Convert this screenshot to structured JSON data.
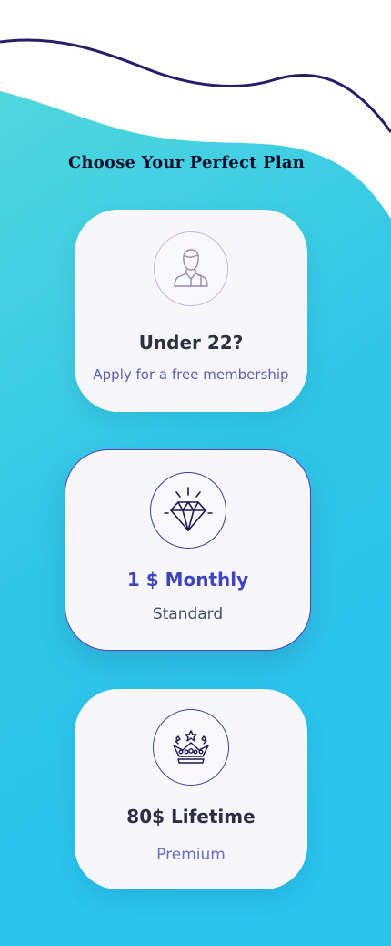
{
  "heading": "Choose Your Perfect Plan",
  "plans": [
    {
      "title": "Under 22?",
      "subtitle": "Apply for a free membership",
      "icon": "student-icon"
    },
    {
      "title": "1 $ Monthly",
      "subtitle": "Standard",
      "icon": "diamond-icon"
    },
    {
      "title": "80$ Lifetime",
      "subtitle": "Premium",
      "icon": "crown-icon"
    }
  ],
  "colors": {
    "background_top": "#ffffff",
    "gradient_start": "#4fd6dd",
    "gradient_end": "#28c2ec",
    "wave_line": "#2b1b6b",
    "card": "#f6f6fb",
    "accent": "#3f45bf"
  }
}
